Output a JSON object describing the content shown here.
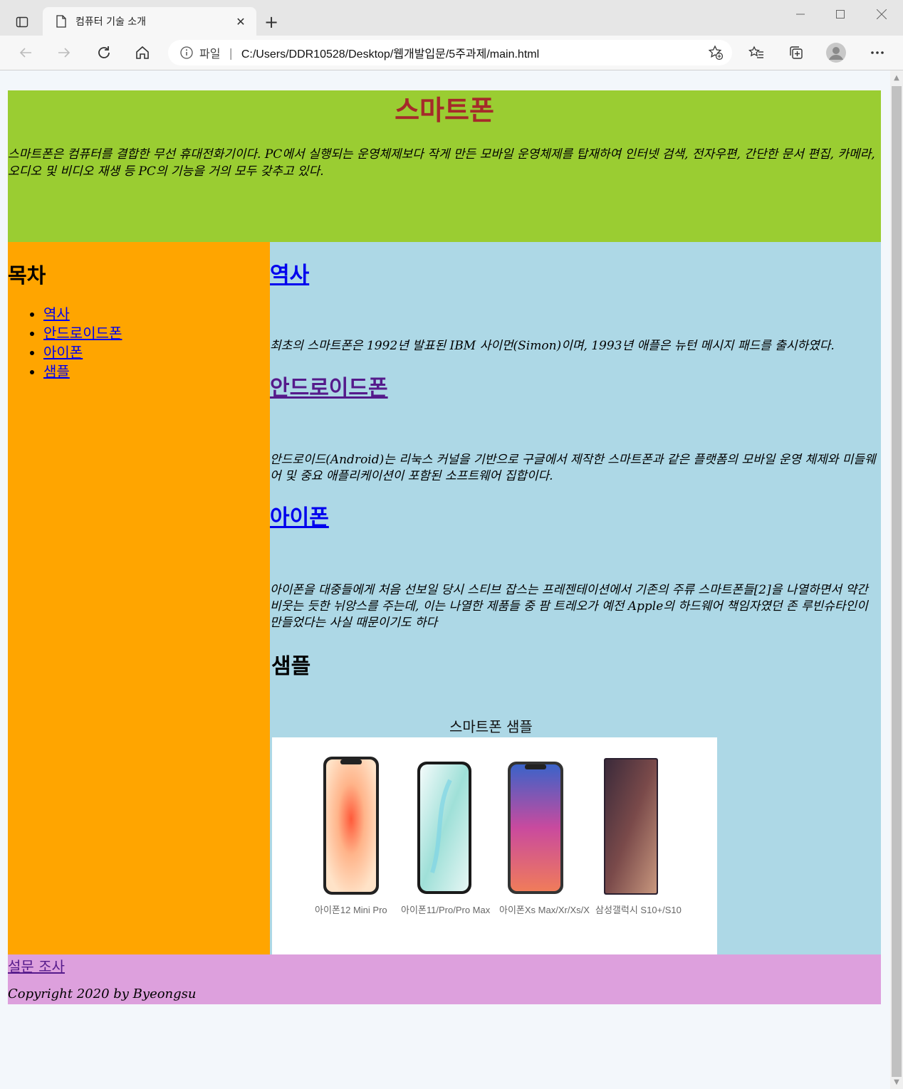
{
  "browser": {
    "tab_title": "컴퓨터 기술 소개",
    "address_scheme": "파일",
    "url": "C:/Users/DDR10528/Desktop/웹개발입문/5주과제/main.html"
  },
  "header": {
    "title": "스마트폰",
    "intro": "스마트폰은 컴퓨터를 결합한 무선 휴대전화기이다. PC에서 실행되는 운영체제보다 작게 만든 모바일 운영체제를 탑재하여 인터넷 검색, 전자우편, 간단한 문서 편집, 카메라, 오디오 및 비디오 재생 등 PC의 기능을 거의 모두 갖추고 있다."
  },
  "toc": {
    "heading": "목차",
    "items": [
      {
        "label": "역사"
      },
      {
        "label": "안드로이드폰"
      },
      {
        "label": "아이폰"
      },
      {
        "label": "샘플"
      }
    ]
  },
  "sections": {
    "history": {
      "heading": "역사",
      "text": "최초의 스마트폰은 1992년 발표된 IBM 사이먼(Simon)이며, 1993년 애플은 뉴턴 메시지 패드를 출시하였다."
    },
    "android": {
      "heading": "안드로이드폰",
      "text": "안드로이드(Android)는 리눅스 커널을 기반으로 구글에서 제작한 스마트폰과 같은 플랫폼의 모바일 운영 체제와 미들웨어 및 중요 애플리케이션이 포함된 소프트웨어 집합이다."
    },
    "iphone": {
      "heading": "아이폰",
      "text": "아이폰을 대중들에게 처음 선보일 당시 스티브 잡스는 프레젠테이션에서 기존의 주류 스마트폰들[2]을 나열하면서 약간 비웃는 듯한 뉘앙스를 주는데, 이는 나열한 제품들 중 팜 트레오가 예전 Apple의 하드웨어 책임자였던 존 루빈슈타인이 만들었다는 사실 때문이기도 하다"
    },
    "sample": {
      "heading": "샘플",
      "caption": "스마트폰 샘플",
      "phones": [
        {
          "label": "아이폰12 Mini Pro"
        },
        {
          "label": "아이폰11/Pro/Pro Max"
        },
        {
          "label": "아이폰Xs Max/Xr/Xs/X"
        },
        {
          "label": "삼성갤럭시 S10+/S10"
        }
      ]
    }
  },
  "footer": {
    "survey_link": "설문 조사",
    "copyright": "Copyright 2020 by Byeongsu"
  },
  "colors": {
    "header_bg": "#9acd32",
    "title": "#a52a2a",
    "toc_bg": "#ffa500",
    "content_bg": "#add8e6",
    "footer_bg": "#dda0dd"
  }
}
